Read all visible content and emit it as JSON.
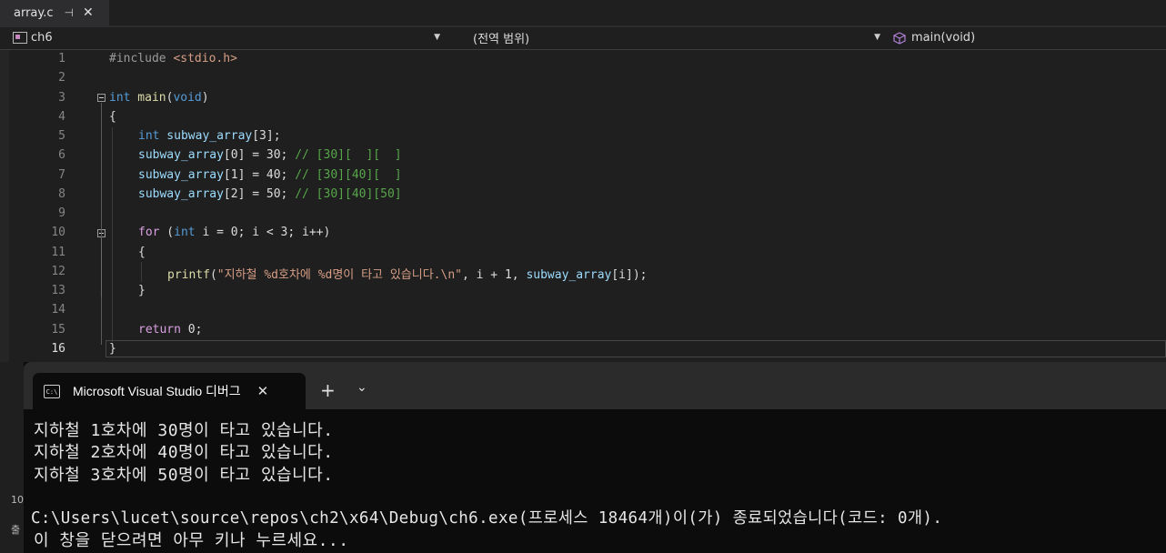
{
  "file_tab": {
    "name": "array.c",
    "pin": "⊣",
    "close": "✕"
  },
  "navbar": {
    "project": "ch6",
    "scope": "(전역 범위)",
    "member": "main(void)"
  },
  "editor": {
    "line_numbers": [
      "1",
      "2",
      "3",
      "4",
      "5",
      "6",
      "7",
      "8",
      "9",
      "10",
      "11",
      "12",
      "13",
      "14",
      "15",
      "16"
    ],
    "lines": {
      "l1": {
        "a": "#include ",
        "b": "<stdio.h>"
      },
      "l3": {
        "a": "int",
        "b": " main",
        "c": "(",
        "d": "void",
        "e": ")"
      },
      "l4": "{",
      "l5": {
        "a": "int",
        "b": " subway_array",
        "c": "[3];"
      },
      "l6": {
        "a": "subway_array",
        "b": "[0] = 30; ",
        "c": "// [30][  ][  ]"
      },
      "l7": {
        "a": "subway_array",
        "b": "[1] = 40; ",
        "c": "// [30][40][  ]"
      },
      "l8": {
        "a": "subway_array",
        "b": "[2] = 50; ",
        "c": "// [30][40][50]"
      },
      "l10": {
        "a": "for",
        "b": " (",
        "c": "int",
        "d": " i = 0; i < 3; i++)"
      },
      "l11": "{",
      "l12": {
        "a": "printf",
        "b": "(",
        "c": "\"지하철 %d호차에 %d명이 타고 있습니다.\\n\"",
        "d": ", i + 1, ",
        "e": "subway_array",
        "f": "[i]);"
      },
      "l13": "}",
      "l15": {
        "a": "return",
        "b": " 0;"
      },
      "l16": "}"
    }
  },
  "terminal": {
    "tab_title": "Microsoft Visual Studio 디버그",
    "tab_icon": "C:\\",
    "plus": "+",
    "chevron": "⌄",
    "output": [
      "지하철 1호차에 30명이 타고 있습니다.",
      "지하철 2호차에 40명이 타고 있습니다.",
      "지하철 3호차에 50명이 타고 있습니다.",
      "",
      "C:\\Users\\lucet\\source\\repos\\ch2\\x64\\Debug\\ch6.exe(프로세스 18464개)이(가) 종료되었습니다(코드: 0개).",
      "이 창을 닫으려면 아무 키나 누르세요..."
    ]
  },
  "side": {
    "label1": "10",
    "label2": "출"
  }
}
